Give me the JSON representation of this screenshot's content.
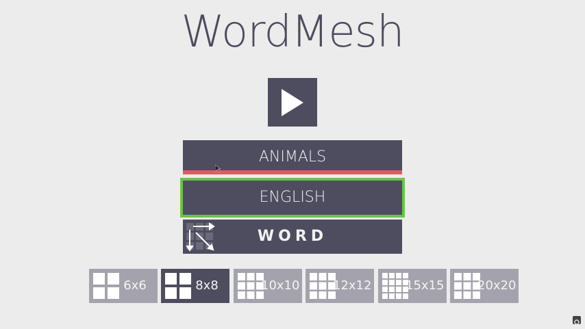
{
  "app": {
    "title": "WordMesh"
  },
  "play": {
    "icon": "play-icon"
  },
  "categories": {
    "topic": "ANIMALS",
    "language": "ENGLISH",
    "mode": "WORD"
  },
  "colors": {
    "dark": "#4d4d5f",
    "inactive": "#a4a3ad",
    "selected_border": "#6cc24a",
    "accent_red": "#e05a60"
  },
  "grid_sizes": [
    {
      "label": "6x6",
      "active": false
    },
    {
      "label": "8x8",
      "active": true
    },
    {
      "label": "10x10",
      "active": false
    },
    {
      "label": "12x12",
      "active": false
    },
    {
      "label": "15x15",
      "active": false
    },
    {
      "label": "20x20",
      "active": false
    }
  ]
}
